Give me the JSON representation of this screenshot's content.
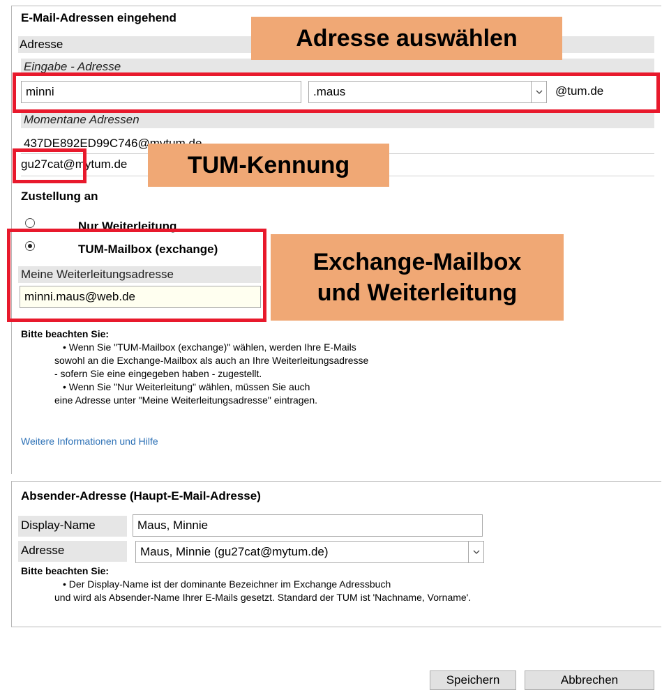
{
  "incoming": {
    "title": "E-Mail-Adressen eingehend",
    "address_label": "Adresse",
    "input_label": "Eingabe - Adresse",
    "local_part_value": "minni",
    "suffix_selected": ".maus",
    "domain_text": "@tum.de",
    "current_label": "Momentane Adressen",
    "current_addresses": [
      "437DE892ED99C746@mytum.de",
      "gu27cat@mytum.de"
    ]
  },
  "delivery": {
    "title": "Zustellung an",
    "option_forward": "Nur Weiterleitung",
    "option_mailbox": "TUM-Mailbox (exchange)",
    "forward_label": "Meine Weiterleitungsadresse",
    "forward_value": "minni.maus@web.de"
  },
  "notes1": {
    "heading": "Bitte beachten Sie:",
    "lines": [
      "• Wenn Sie \"TUM-Mailbox (exchange)\" wählen, werden Ihre E-Mails",
      "sowohl an die Exchange-Mailbox als auch an Ihre Weiterleitungsadresse",
      "- sofern Sie eine eingegeben haben - zugestellt.",
      "• Wenn Sie \"Nur Weiterleitung\" wählen, müssen Sie auch",
      "eine Adresse unter \"Meine Weiterleitungsadresse\" eintragen."
    ],
    "help_link": "Weitere Informationen und Hilfe"
  },
  "sender": {
    "title": "Absender-Adresse (Haupt-E-Mail-Adresse)",
    "display_name_label": "Display-Name",
    "display_name_value": "Maus, Minnie",
    "address_label": "Adresse",
    "address_selected": "Maus, Minnie (gu27cat@mytum.de)",
    "note_heading": "Bitte beachten Sie:",
    "note_lines": [
      "• Der Display-Name ist der dominante Bezeichner im Exchange Adressbuch",
      "und wird als Absender-Name Ihrer E-Mails gesetzt. Standard der TUM ist 'Nachname, Vorname'."
    ]
  },
  "buttons": {
    "save": "Speichern",
    "cancel": "Abbrechen"
  },
  "callouts": {
    "address": "Adresse auswählen",
    "tum_id": "TUM-Kennung",
    "exchange_line1": "Exchange-Mailbox",
    "exchange_line2": "und Weiterleitung"
  },
  "colors": {
    "callout_bg": "#f0a875",
    "highlight_red": "#e8192c",
    "link": "#2a6fb5"
  },
  "icons": {
    "select_arrow": "chevron-down-icon"
  }
}
